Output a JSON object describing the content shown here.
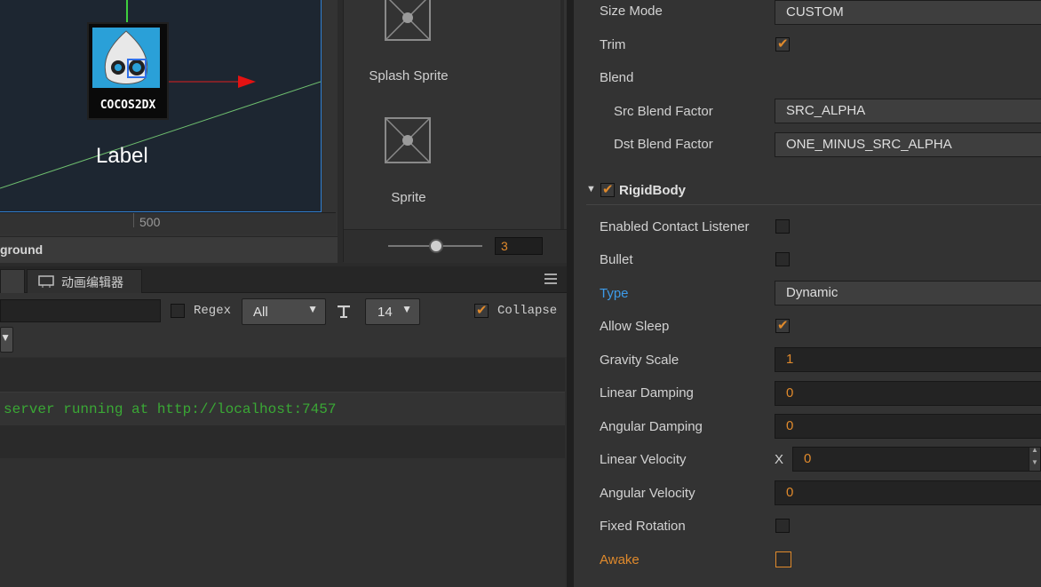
{
  "scene": {
    "label_text": "Label",
    "logo_text": "COCOS2DX",
    "ruler_value": "500",
    "node_path": "ground"
  },
  "assets": {
    "items": [
      {
        "name": "Splash Sprite"
      },
      {
        "name": "Sprite"
      }
    ],
    "zoom_value": "3"
  },
  "console": {
    "tabs": [
      {
        "label": "动画编辑器"
      }
    ],
    "regex_label": "Regex",
    "filter_select": "All",
    "font_size_select": "14",
    "collapse_label": "Collapse",
    "log_message": "server running at http://localhost:7457"
  },
  "inspector": {
    "size_mode": {
      "label": "Size Mode",
      "value": "CUSTOM"
    },
    "trim": {
      "label": "Trim",
      "checked": true
    },
    "blend": {
      "label": "Blend"
    },
    "src_blend": {
      "label": "Src Blend Factor",
      "value": "SRC_ALPHA"
    },
    "dst_blend": {
      "label": "Dst Blend Factor",
      "value": "ONE_MINUS_SRC_ALPHA"
    },
    "rigidbody": {
      "title": "RigidBody",
      "enabled": true
    },
    "contact_listener": {
      "label": "Enabled Contact Listener",
      "checked": false
    },
    "bullet": {
      "label": "Bullet",
      "checked": false
    },
    "type": {
      "label": "Type",
      "value": "Dynamic"
    },
    "allow_sleep": {
      "label": "Allow Sleep",
      "checked": true
    },
    "gravity_scale": {
      "label": "Gravity Scale",
      "value": "1"
    },
    "linear_damping": {
      "label": "Linear Damping",
      "value": "0"
    },
    "angular_damping": {
      "label": "Angular Damping",
      "value": "0"
    },
    "linear_velocity": {
      "label": "Linear Velocity",
      "axis": "X",
      "value": "0"
    },
    "angular_velocity": {
      "label": "Angular Velocity",
      "value": "0"
    },
    "fixed_rotation": {
      "label": "Fixed Rotation",
      "checked": false
    },
    "awake": {
      "label": "Awake",
      "checked": false
    }
  },
  "colors": {
    "accent_orange": "#e08a2c",
    "highlight_blue": "#3d9be9",
    "log_green": "#3aa835"
  }
}
